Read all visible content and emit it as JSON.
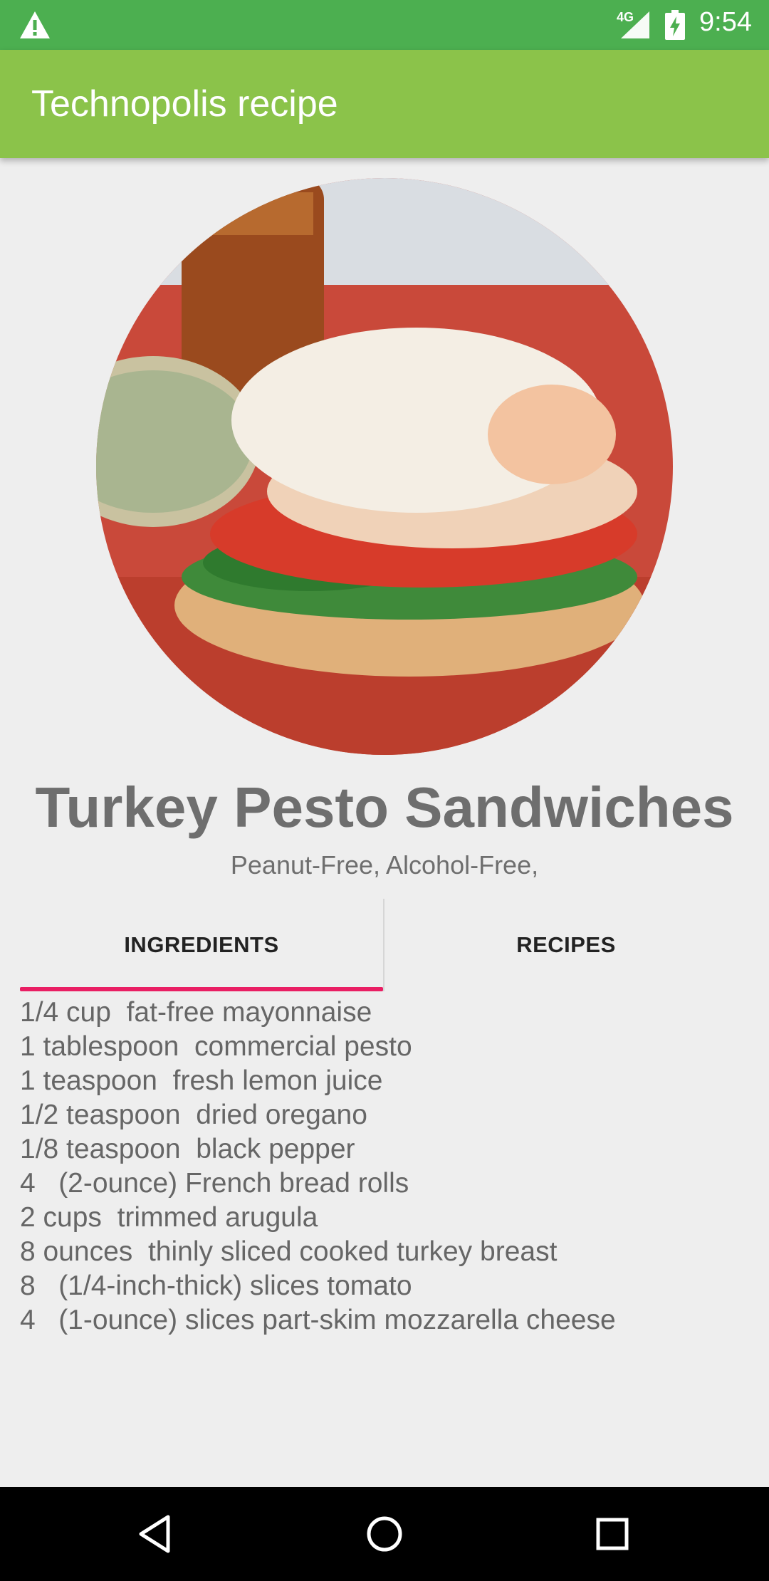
{
  "status_bar": {
    "network": "4G",
    "time": "9:54"
  },
  "app_bar": {
    "title": "Technopolis recipe"
  },
  "recipe": {
    "image_icon": "recipe-photo",
    "title": "Turkey Pesto Sandwiches",
    "tags": "Peanut-Free, Alcohol-Free,"
  },
  "tabs": [
    {
      "label": "INGREDIENTS",
      "selected": true
    },
    {
      "label": "RECIPES",
      "selected": false
    }
  ],
  "tab_indicator_color": "#e91e63",
  "ingredients": [
    "1/4 cup  fat-free mayonnaise",
    "1 tablespoon  commercial pesto",
    "1 teaspoon  fresh lemon juice",
    "1/2 teaspoon  dried oregano",
    "1/8 teaspoon  black pepper",
    "4   (2-ounce) French bread rolls",
    "2 cups  trimmed arugula",
    "8 ounces  thinly sliced cooked turkey breast",
    "8   (1/4-inch-thick) slices tomato",
    "4   (1-ounce) slices part-skim mozzarella cheese"
  ],
  "nav_bar": {
    "icons": [
      "back-icon",
      "home-icon",
      "recents-icon"
    ]
  },
  "colors": {
    "status_bar": "#4caf50",
    "app_bar": "#8bc34a",
    "background": "#eeeeee"
  }
}
